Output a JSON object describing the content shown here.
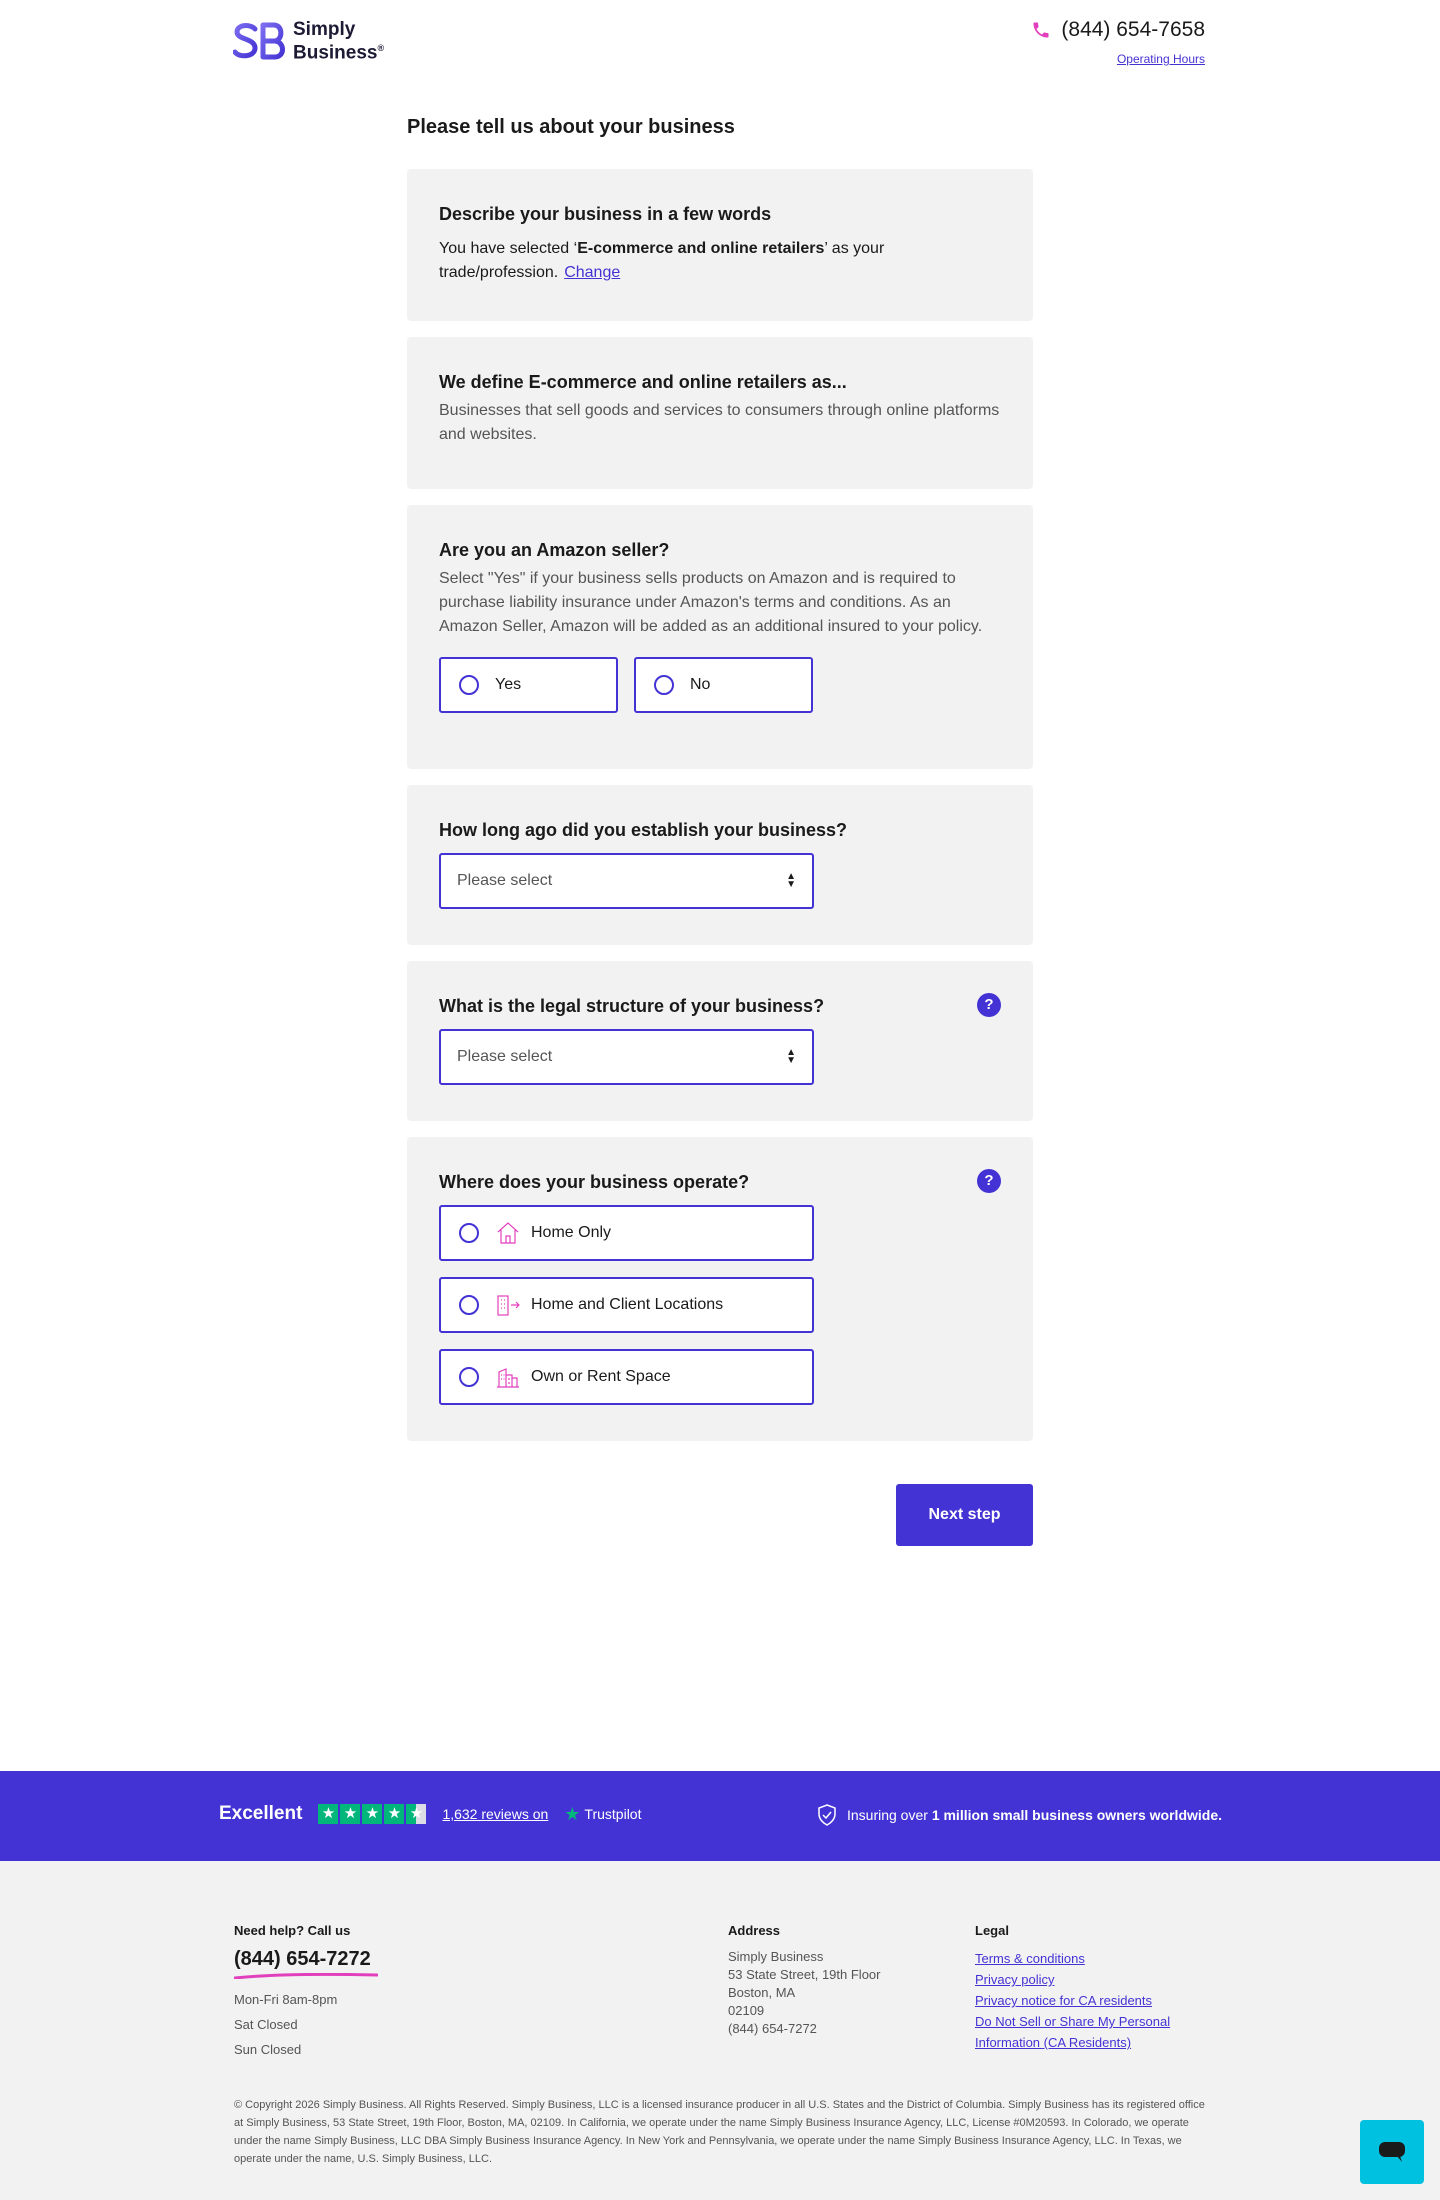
{
  "brand": {
    "logo_text_line1": "Simply",
    "logo_text_line2": "Business",
    "registered_mark": "®",
    "accent_color": "#4433d4",
    "accent_pink": "#e23fbd"
  },
  "header": {
    "phone": "(844) 654-7658",
    "operating_hours_label": "Operating Hours"
  },
  "page_title": "Please tell us about your business",
  "cards": {
    "describe": {
      "title": "Describe your business in a few words",
      "text_before": "You have selected ‘",
      "selected_trade": "E-commerce and online retailers",
      "text_after": "’ as your trade/profession.",
      "change_label": "Change"
    },
    "define": {
      "title": "We define E-commerce and online retailers as...",
      "text": "Businesses that sell goods and services to consumers through online platforms and websites."
    },
    "amazon": {
      "title": "Are you an Amazon seller?",
      "text": "Select \"Yes\" if your business sells products on Amazon and is required to purchase liability insurance under Amazon's terms and conditions. As an Amazon Seller, Amazon will be added as an additional insured to your policy.",
      "yes_label": "Yes",
      "no_label": "No"
    },
    "established": {
      "title": "How long ago did you establish your business?",
      "select_value": "Please select"
    },
    "legal": {
      "title": "What is the legal structure of your business?",
      "select_value": "Please select",
      "help": "?"
    },
    "operate": {
      "title": "Where does your business operate?",
      "help": "?",
      "options": [
        "Home Only",
        "Home and Client Locations",
        "Own or Rent Space"
      ]
    }
  },
  "next_button": "Next step",
  "trust_band": {
    "excellent": "Excellent",
    "rating_stars": 4.5,
    "reviews_link": "1,632 reviews on",
    "trustpilot": "Trustpilot",
    "insuring_prefix": "Insuring over ",
    "insuring_bold": "1 million small business owners worldwide."
  },
  "footer": {
    "help_heading": "Need help? Call us",
    "help_phone": "(844) 654-7272",
    "hours": [
      "Mon-Fri 8am-8pm",
      "Sat Closed",
      "Sun Closed"
    ],
    "address_heading": "Address",
    "address_lines": [
      "Simply Business",
      "53 State Street, 19th Floor",
      "Boston, MA",
      "02109",
      "(844) 654-7272"
    ],
    "legal_heading": "Legal",
    "legal_links": [
      "Terms & conditions",
      "Privacy policy",
      "Privacy notice for CA residents",
      "Do Not Sell or Share My Personal Information (CA Residents)"
    ],
    "copyright": "© Copyright 2026 Simply Business. All Rights Reserved. Simply Business, LLC is a licensed insurance producer in all U.S. States and the District of Columbia. Simply Business has its registered office at Simply Business, 53 State Street, 19th Floor, Boston, MA, 02109. In California, we operate under the name Simply Business Insurance Agency, LLC, License #0M20593. In Colorado, we operate under the name Simply Business, LLC DBA Simply Business Insurance Agency. In New York and Pennsylvania, we operate under the name Simply Business Insurance Agency, LLC. In Texas, we operate under the name, U.S. Simply Business, LLC."
  },
  "chat": {
    "icon": "chat-icon",
    "color": "#00c2e0"
  }
}
